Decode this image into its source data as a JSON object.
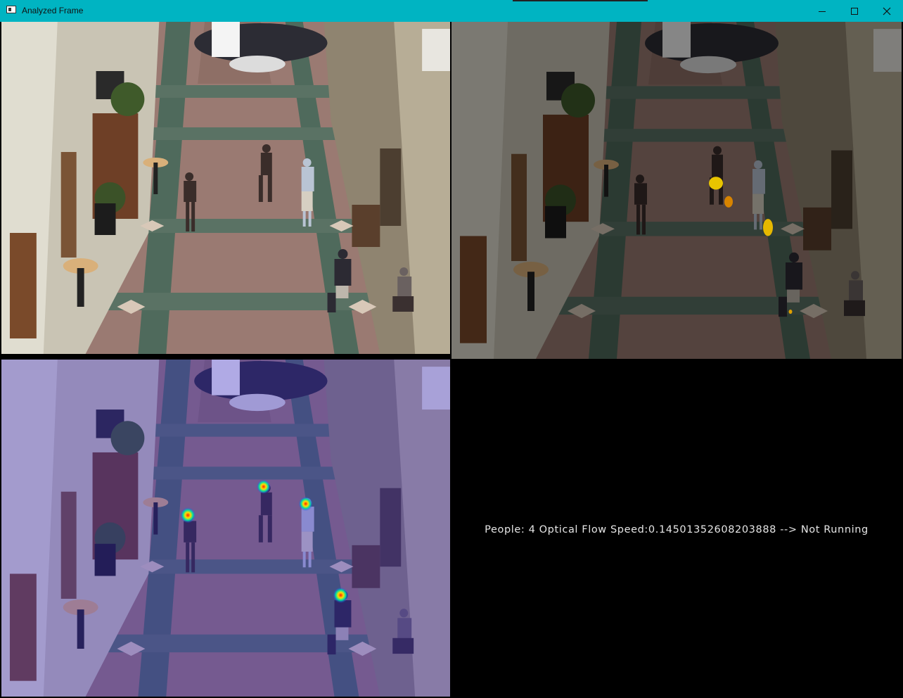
{
  "window": {
    "title": "Analyzed Frame",
    "icon": "app-window-icon",
    "controls": [
      "minimize-icon",
      "maximize-icon",
      "close-icon"
    ],
    "titlebar_color": "#00b4c2"
  },
  "panels": {
    "original_frame": {
      "content": "surveillance camera frame of atrium hallway"
    },
    "motion_overlay": {
      "content": "frame with yellow/orange optical flow blobs",
      "overlay_color": "#e8b400"
    },
    "head_heatmap": {
      "content": "frame with blue tint and head detection heat spots",
      "detections": 4
    },
    "status": {
      "text": "People: 4 Optical Flow Speed:0.14501352608203888 --> Not Running",
      "people_count": 4,
      "optical_flow_speed": 0.14501352608203888,
      "classification": "Not Running"
    }
  }
}
